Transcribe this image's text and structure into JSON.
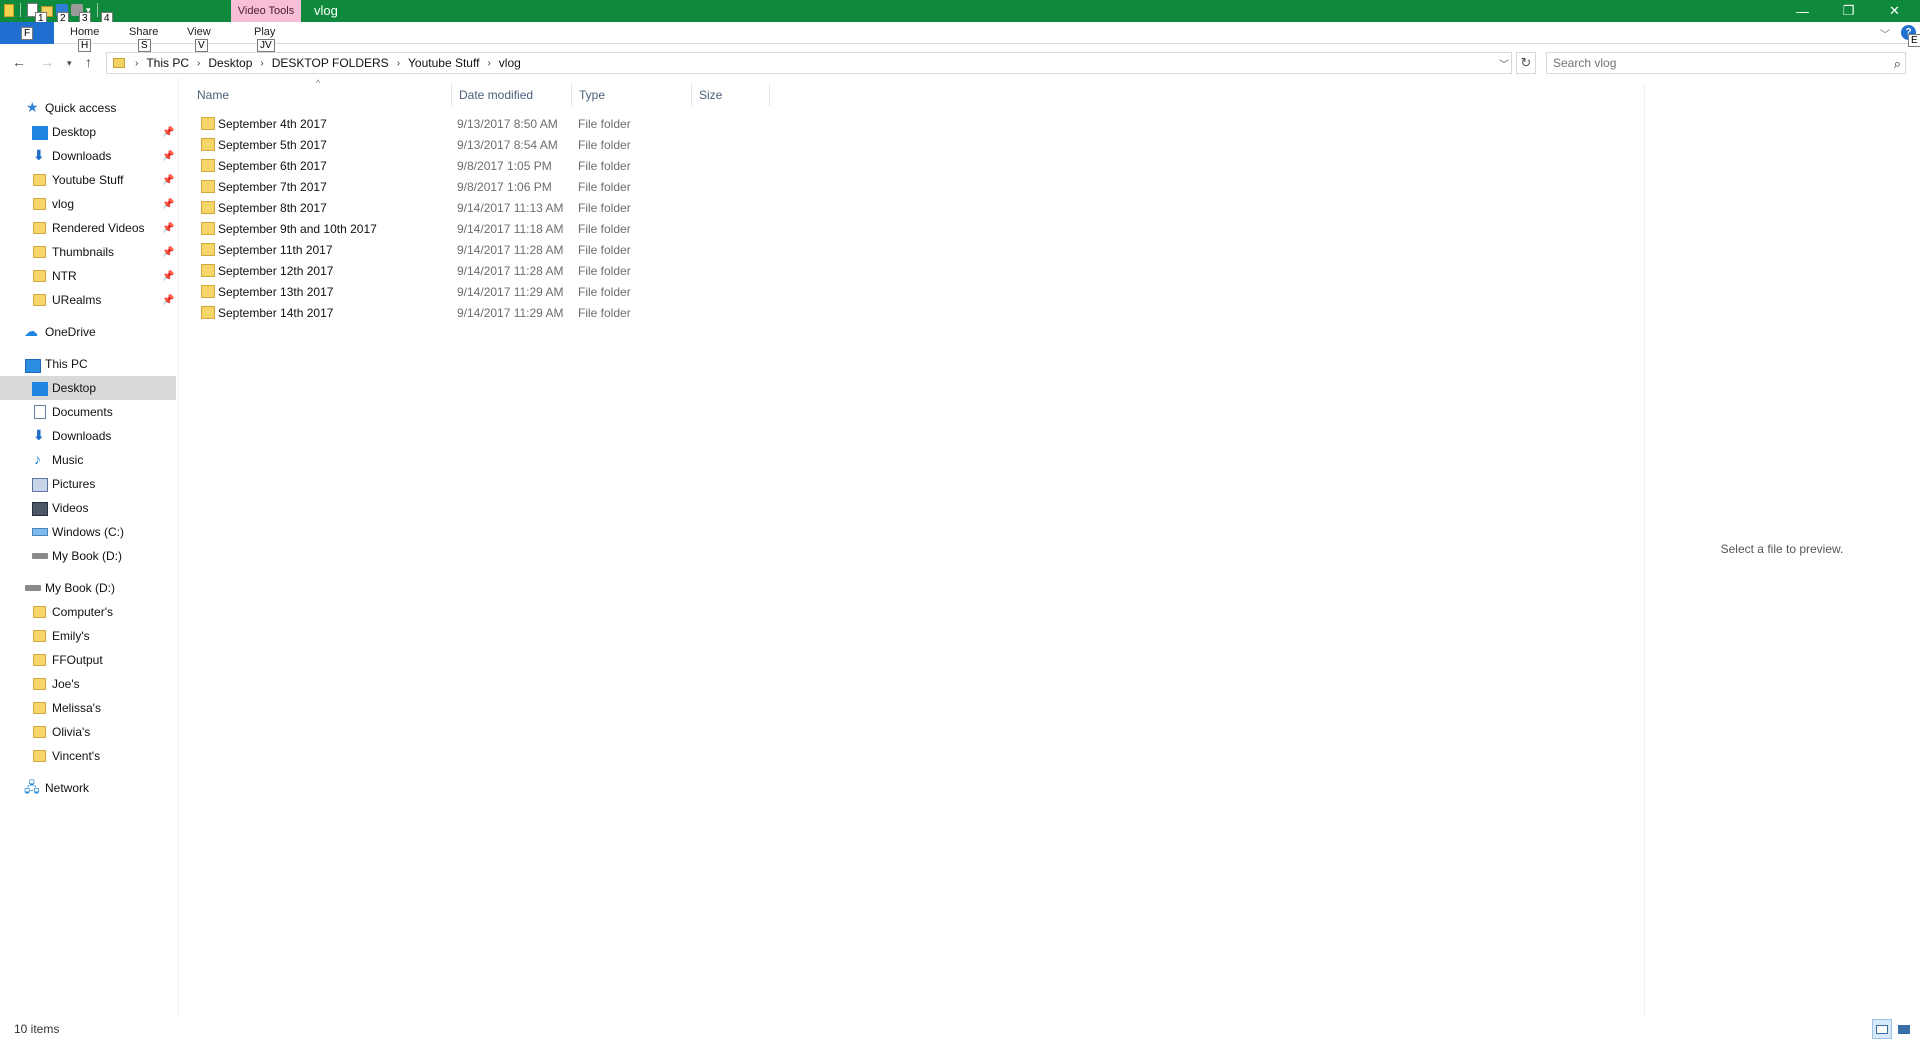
{
  "window": {
    "title": "vlog",
    "context_tab": "Video Tools",
    "minimize": "—",
    "restore": "❐",
    "close": "✕"
  },
  "qat": {
    "keytips": [
      "1",
      "2",
      "3",
      "4"
    ]
  },
  "ribbon": {
    "file_label": "F",
    "tabs": [
      {
        "label": "Home",
        "keytip": "H"
      },
      {
        "label": "Share",
        "keytip": "S"
      },
      {
        "label": "View",
        "keytip": "V"
      },
      {
        "label": "Play",
        "keytip": "JV"
      }
    ],
    "help_keytip": "E"
  },
  "address": {
    "crumbs": [
      "This PC",
      "Desktop",
      "DESKTOP FOLDERS",
      "Youtube Stuff",
      "vlog"
    ]
  },
  "search": {
    "placeholder": "Search vlog"
  },
  "nav": {
    "quick_access": "Quick access",
    "quick_items": [
      "Desktop",
      "Downloads",
      "Youtube Stuff",
      "vlog",
      "Rendered Videos",
      "Thumbnails",
      "NTR",
      "URealms"
    ],
    "onedrive": "OneDrive",
    "this_pc": "This PC",
    "pc_items": [
      "Desktop",
      "Documents",
      "Downloads",
      "Music",
      "Pictures",
      "Videos",
      "Windows (C:)",
      "My Book (D:)"
    ],
    "mybook": "My Book (D:)",
    "mybook_items": [
      "Computer's",
      "Emily's",
      "FFOutput",
      "Joe's",
      "Melissa's",
      "Olivia's",
      "Vincent's"
    ],
    "network": "Network"
  },
  "columns": {
    "name": "Name",
    "date": "Date modified",
    "type": "Type",
    "size": "Size"
  },
  "files": [
    {
      "name": "September 4th 2017",
      "date": "9/13/2017 8:50 AM",
      "type": "File folder"
    },
    {
      "name": "September 5th 2017",
      "date": "9/13/2017 8:54 AM",
      "type": "File folder"
    },
    {
      "name": "September 6th 2017",
      "date": "9/8/2017 1:05 PM",
      "type": "File folder"
    },
    {
      "name": "September 7th 2017",
      "date": "9/8/2017 1:06 PM",
      "type": "File folder"
    },
    {
      "name": "September 8th 2017",
      "date": "9/14/2017 11:13 AM",
      "type": "File folder"
    },
    {
      "name": "September 9th and 10th 2017",
      "date": "9/14/2017 11:18 AM",
      "type": "File folder"
    },
    {
      "name": "September 11th 2017",
      "date": "9/14/2017 11:28 AM",
      "type": "File folder"
    },
    {
      "name": "September 12th 2017",
      "date": "9/14/2017 11:28 AM",
      "type": "File folder"
    },
    {
      "name": "September 13th 2017",
      "date": "9/14/2017 11:29 AM",
      "type": "File folder"
    },
    {
      "name": "September 14th 2017",
      "date": "9/14/2017 11:29 AM",
      "type": "File folder"
    }
  ],
  "preview": {
    "message": "Select a file to preview."
  },
  "status": {
    "item_count": "10 items"
  }
}
